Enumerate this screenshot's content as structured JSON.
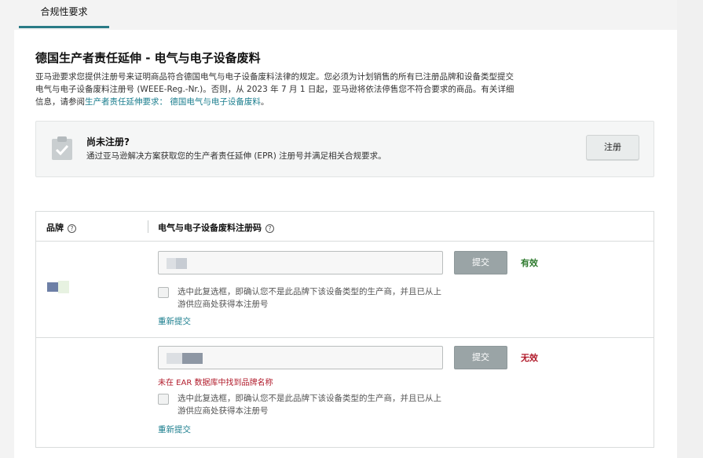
{
  "tabs": [
    {
      "label": "合规性要求"
    }
  ],
  "section": {
    "title": "德国生产者责任延伸 - 电气与电子设备废料",
    "description_prefix": "亚马逊要求您提供注册号来证明商品符合德国电气与电子设备废料法律的规定。您必须为计划销售的所有已注册品牌和设备类型提交电气与电子设备废料注册号 (WEEE-Reg.-Nr.)。否则，从 2023 年 7 月 1 日起，亚马逊将依法停售您不符合要求的商品。有关详细信息，请参阅",
    "description_link": "生产者责任延伸要求： 德国电气与电子设备废料",
    "description_suffix": "。"
  },
  "notice": {
    "icon": "clipboard-check-icon",
    "title": "尚未注册?",
    "text": "通过亚马逊解决方案获取您的生产者责任延伸 (EPR) 注册号并满足相关合规要求。",
    "button_label": "注册"
  },
  "table": {
    "headers": {
      "brand": "品牌",
      "code": "电气与电子设备废料注册码",
      "help_glyph": "?"
    },
    "rows": [
      {
        "submit_label": "提交",
        "status": "有效",
        "status_color": "#2e7a2e",
        "error": "",
        "checkbox_checked": false,
        "checkbox_label": "选中此复选框，即确认您不是此品牌下该设备类型的生产商，并且已从上游供应商处获得本注册号",
        "resubmit_label": "重新提交"
      },
      {
        "submit_label": "提交",
        "status": "无效",
        "status_color": "#b11b2b",
        "error": "未在 EAR 数据库中找到品牌名称",
        "checkbox_checked": false,
        "checkbox_label": "选中此复选框，即确认您不是此品牌下该设备类型的生产商，并且已从上游供应商处获得本注册号",
        "resubmit_label": "重新提交"
      }
    ]
  },
  "colors": {
    "accent": "#2a7b86",
    "link": "#1b7e8e",
    "valid": "#2e7a2e",
    "invalid": "#b11b2b"
  }
}
